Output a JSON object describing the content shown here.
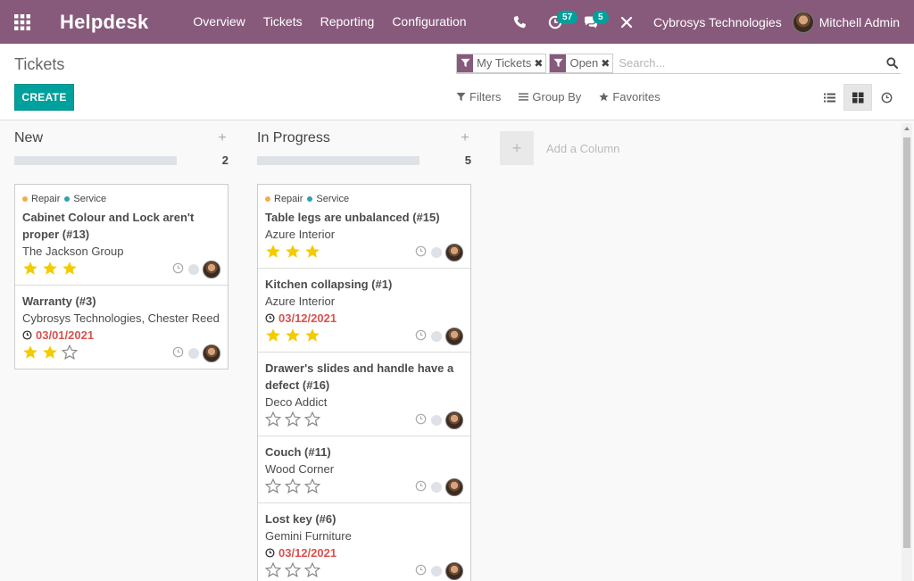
{
  "navbar": {
    "app_name": "Helpdesk",
    "menu": [
      "Overview",
      "Tickets",
      "Reporting",
      "Configuration"
    ],
    "activity_count": "57",
    "message_count": "5",
    "company": "Cybrosys Technologies",
    "user": "Mitchell Admin",
    "color": "#875a7b"
  },
  "control": {
    "breadcrumb": "Tickets",
    "create_label": "CREATE",
    "facets": [
      "My Tickets",
      "Open"
    ],
    "search_placeholder": "Search...",
    "filters_label": "Filters",
    "groupby_label": "Group By",
    "favorites_label": "Favorites"
  },
  "kanban": {
    "add_column_label": "Add a Column",
    "columns": [
      {
        "title": "New",
        "count": "2",
        "cards": [
          {
            "title": "Cabinet Colour and Lock aren't proper (#13)",
            "partner": "The Jackson Group",
            "date": "",
            "tags": [
              "Repair",
              "Service"
            ],
            "stars": 3
          },
          {
            "title": "Warranty (#3)",
            "partner": "Cybrosys Technologies, Chester Reed",
            "date": "03/01/2021",
            "tags": [],
            "stars": 2
          }
        ]
      },
      {
        "title": "In Progress",
        "count": "5",
        "cards": [
          {
            "title": "Table legs are unbalanced (#15)",
            "partner": "Azure Interior",
            "date": "",
            "tags": [
              "Repair",
              "Service"
            ],
            "stars": 3
          },
          {
            "title": "Kitchen collapsing (#1)",
            "partner": "Azure Interior",
            "date": "03/12/2021",
            "tags": [],
            "stars": 3
          },
          {
            "title": "Drawer's slides and handle have a defect (#16)",
            "partner": "Deco Addict",
            "date": "",
            "tags": [],
            "stars": 0
          },
          {
            "title": "Couch (#11)",
            "partner": "Wood Corner",
            "date": "",
            "tags": [],
            "stars": 0
          },
          {
            "title": "Lost key (#6)",
            "partner": "Gemini Furniture",
            "date": "03/12/2021",
            "tags": [],
            "stars": 0
          }
        ]
      }
    ]
  },
  "colors": {
    "accent": "#00a09d",
    "overdue": "#d9534f",
    "star": "#f3cc00",
    "tag_repair": "#f0ad4e",
    "tag_service": "#30a0b5"
  }
}
